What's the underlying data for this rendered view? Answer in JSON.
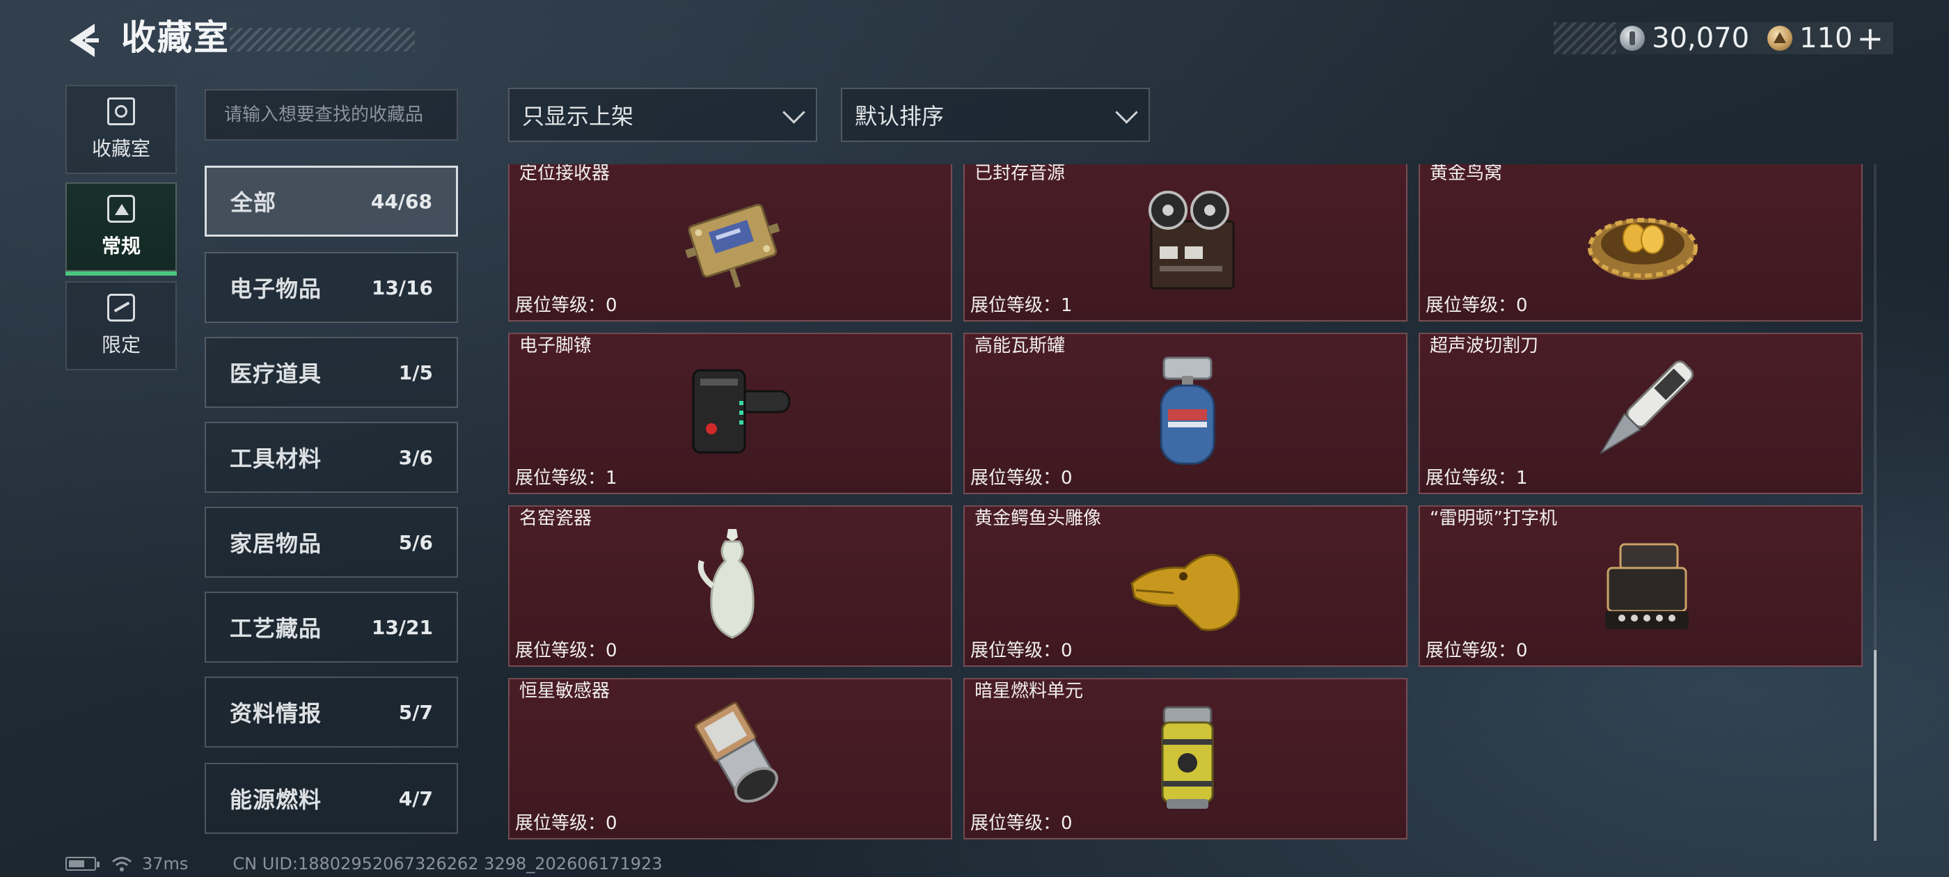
{
  "header": {
    "title": "收藏室"
  },
  "currency": {
    "silver_value": "30,070",
    "gold_value": "110",
    "plus_symbol": "+"
  },
  "side_tabs": [
    {
      "label": "收藏室",
      "icon": "vault-icon",
      "active": false
    },
    {
      "label": "常规",
      "icon": "regular-icon",
      "active": true
    },
    {
      "label": "限定",
      "icon": "limited-icon",
      "active": false
    }
  ],
  "search": {
    "placeholder": "请输入想要查找的收藏品"
  },
  "categories": [
    {
      "name": "全部",
      "count": "44/68",
      "active": true
    },
    {
      "name": "电子物品",
      "count": "13/16"
    },
    {
      "name": "医疗道具",
      "count": "1/5"
    },
    {
      "name": "工具材料",
      "count": "3/6"
    },
    {
      "name": "家居物品",
      "count": "5/6"
    },
    {
      "name": "工艺藏品",
      "count": "13/21"
    },
    {
      "name": "资料情报",
      "count": "5/7"
    },
    {
      "name": "能源燃料",
      "count": "4/7"
    }
  ],
  "filters": {
    "shelf_filter": "只显示上架",
    "sort": "默认排序"
  },
  "items": [
    {
      "name": "定位接收器",
      "level": "展位等级：0",
      "icon": "locator-receiver-icon"
    },
    {
      "name": "已封存音源",
      "level": "展位等级：1",
      "icon": "reel-tape-recorder-icon"
    },
    {
      "name": "黄金鸟窝",
      "level": "展位等级：0",
      "icon": "golden-nest-icon"
    },
    {
      "name": "电子脚镣",
      "level": "展位等级：1",
      "icon": "electronic-anklet-icon"
    },
    {
      "name": "高能瓦斯罐",
      "level": "展位等级：0",
      "icon": "gas-canister-icon"
    },
    {
      "name": "超声波切割刀",
      "level": "展位等级：1",
      "icon": "ultrasonic-cutter-icon"
    },
    {
      "name": "名窑瓷器",
      "level": "展位等级：0",
      "icon": "porcelain-vase-icon"
    },
    {
      "name": "黄金鳄鱼头雕像",
      "level": "展位等级：0",
      "icon": "golden-crocodile-icon"
    },
    {
      "name": "“雷明顿”打字机",
      "level": "展位等级：0",
      "icon": "typewriter-icon"
    },
    {
      "name": "恒星敏感器",
      "level": "展位等级：0",
      "icon": "star-sensor-icon"
    },
    {
      "name": "暗星燃料单元",
      "level": "展位等级：0",
      "icon": "fuel-cell-icon"
    }
  ],
  "status": {
    "ping": "37ms",
    "uid": "CN UID:18802952067326262 3298_202606171923"
  },
  "colors": {
    "card_bg": "#4a1d26",
    "active_tab_accent": "#4ac87e"
  }
}
